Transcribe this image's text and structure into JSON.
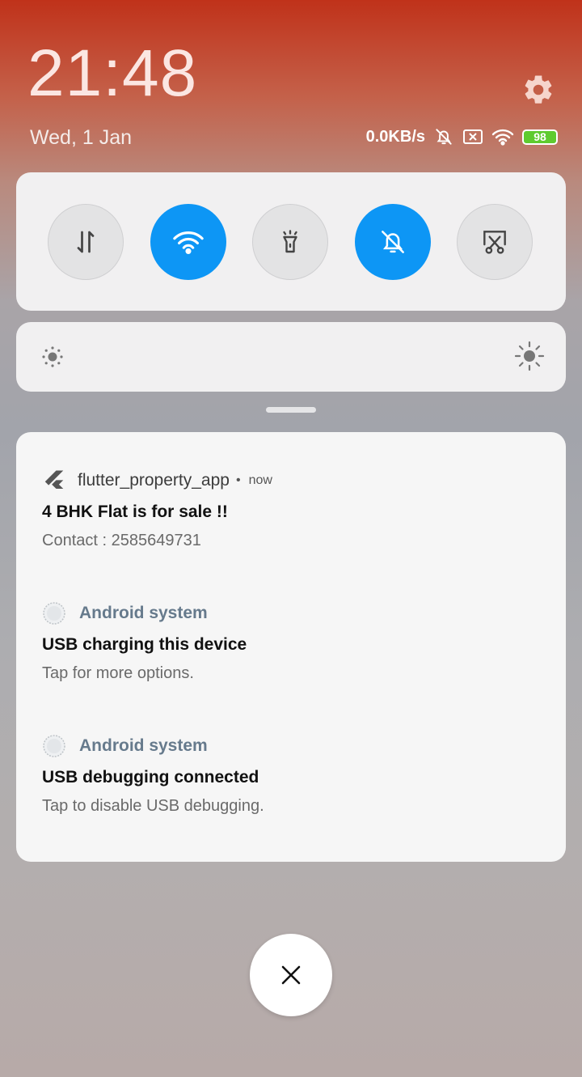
{
  "header": {
    "time": "21:48",
    "date": "Wed, 1 Jan",
    "net_speed": "0.0KB/s",
    "battery_level": "98"
  },
  "toggles": [
    {
      "name": "mobile-data",
      "icon": "data-arrows-icon",
      "state": "off"
    },
    {
      "name": "wifi",
      "icon": "wifi-icon",
      "state": "on"
    },
    {
      "name": "flashlight",
      "icon": "flashlight-icon",
      "state": "off"
    },
    {
      "name": "silent",
      "icon": "bell-off-icon",
      "state": "on"
    },
    {
      "name": "screenshot",
      "icon": "scissors-icon",
      "state": "off"
    }
  ],
  "notifications": [
    {
      "app": "flutter_property_app",
      "time": "now",
      "title": "4 BHK Flat is for sale !!",
      "text": "Contact : 2585649731"
    },
    {
      "app": "Android system",
      "title": "USB charging this device",
      "text": "Tap for more options."
    },
    {
      "app": "Android system",
      "title": "USB debugging connected",
      "text": "Tap to disable USB debugging."
    }
  ],
  "colors": {
    "accent": "#0d96f5",
    "battery": "#5ecb2f"
  }
}
